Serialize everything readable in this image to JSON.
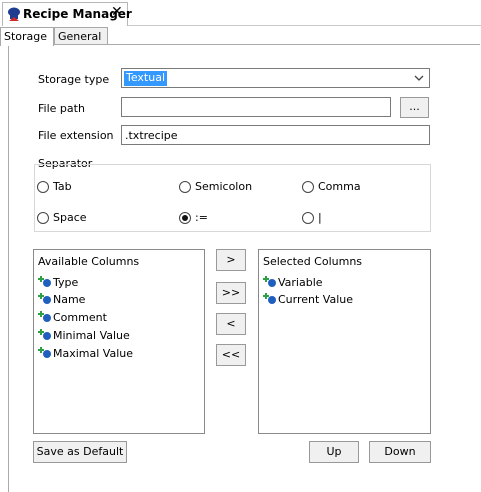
{
  "window": {
    "tab_title": "Recipe Manager"
  },
  "tabs": [
    "Storage",
    "General"
  ],
  "storage": {
    "storage_type_label": "Storage type",
    "storage_type_value": "Textual",
    "file_path_label": "File path",
    "file_path_value": "",
    "browse_label": "...",
    "file_extension_label": "File extension",
    "file_extension_value": ".txtrecipe"
  },
  "separator": {
    "title": "Separator",
    "options": [
      {
        "label": "Tab",
        "selected": false
      },
      {
        "label": "Semicolon",
        "selected": false
      },
      {
        "label": "Comma",
        "selected": false
      },
      {
        "label": "Space",
        "selected": false
      },
      {
        "label": ":=",
        "selected": true
      },
      {
        "label": "|",
        "selected": false
      }
    ]
  },
  "available": {
    "title": "Available Columns",
    "items": [
      "Type",
      "Name",
      "Comment",
      "Minimal Value",
      "Maximal Value"
    ]
  },
  "selected": {
    "title": "Selected Columns",
    "items": [
      "Variable",
      "Current Value"
    ]
  },
  "move_buttons": [
    ">",
    ">>",
    "<",
    "<<"
  ],
  "buttons": {
    "save_default": "Save as Default",
    "up": "Up",
    "down": "Down"
  },
  "icons": {
    "tab_icon": "chef-hat-icon",
    "column_icon": "variable-icon"
  },
  "colors": {
    "selection": "#3399ff",
    "icon_green": "#2ea043",
    "icon_blue": "#1f5fbf"
  }
}
